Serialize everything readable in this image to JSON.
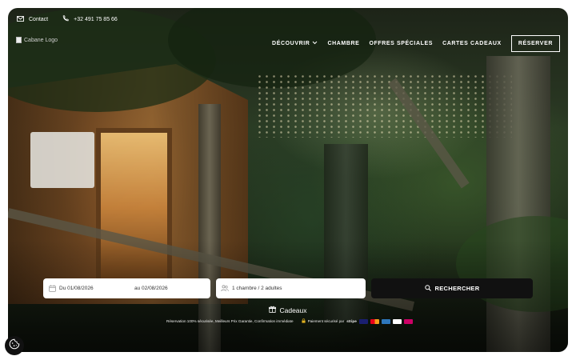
{
  "topbar": {
    "contact_label": "Contact",
    "phone": "+32 491 75 85 66",
    "icons": {
      "contact": "envelope-icon",
      "phone": "phone-icon"
    }
  },
  "logo": {
    "alt": "Cabane Logo"
  },
  "nav": {
    "items": [
      {
        "label": "DÉCOUVRIR",
        "has_dropdown": true
      },
      {
        "label": "CHAMBRE"
      },
      {
        "label": "OFFRES SPÉCIALES"
      },
      {
        "label": "CARTES CADEAUX"
      }
    ],
    "cta": "RÉSERVER"
  },
  "search": {
    "date_from": "Du 01/08/2026",
    "date_to": "au 02/08/2026",
    "guests": "1 chambre / 2 adultes",
    "button": "RECHERCHER",
    "icons": {
      "calendar": "calendar-icon",
      "guests": "people-icon",
      "search": "search-icon"
    }
  },
  "gifts": {
    "label": "Cadeaux",
    "icon": "gift-icon"
  },
  "trust": {
    "guarantees": "Réservation 100% sécurisée, Meilleurs Prix Garantie, Confirmation immédiate",
    "payment": "Paiement sécurisé par",
    "provider": "stripe"
  },
  "colors": {
    "accent": "#111111",
    "text_light": "#ffffff"
  },
  "cookie": {
    "icon": "cookie-icon"
  }
}
